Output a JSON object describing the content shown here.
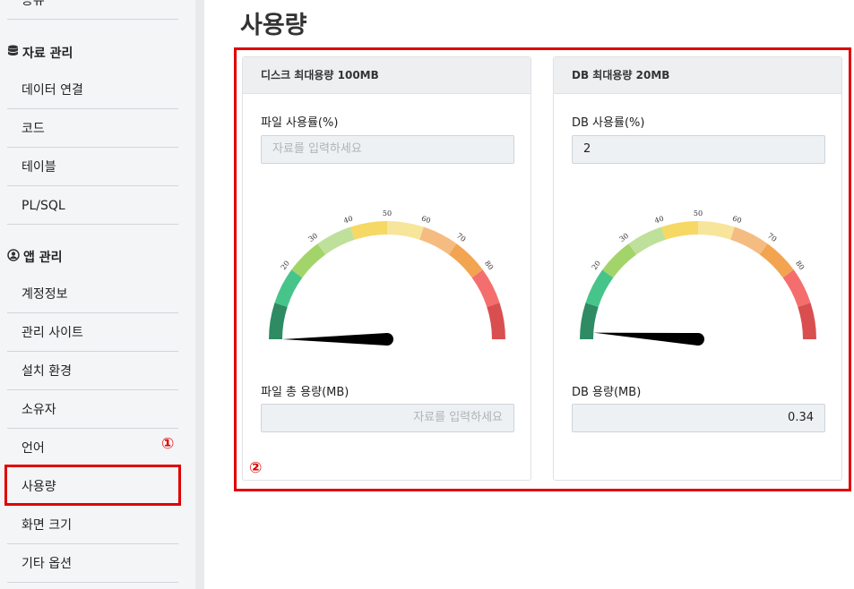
{
  "sidebar": {
    "items_top": [
      "공유"
    ],
    "section_data": {
      "label": "자료 관리",
      "icon": "database-icon"
    },
    "data_items": [
      "데이터 연결",
      "코드",
      "테이블",
      "PL/SQL"
    ],
    "section_app": {
      "label": "앱 관리",
      "icon": "user-circle-icon"
    },
    "app_items": [
      "계정정보",
      "관리 사이트",
      "설치 환경",
      "소유자",
      "언어",
      "사용량",
      "화면 크기",
      "기타 옵션"
    ],
    "selected": "사용량"
  },
  "annotations": {
    "marker1": "①",
    "marker2": "②",
    "color": "#e00000"
  },
  "page": {
    "title": "사용량"
  },
  "disk_card": {
    "header": "디스크 최대용량 100MB",
    "usage_label": "파일 사용률(%)",
    "usage_placeholder": "자료를 입력하세요",
    "usage_value": "",
    "gauge_value": 0,
    "total_label": "파일 총 용량(MB)",
    "total_placeholder": "자료를 입력하세요",
    "total_value": ""
  },
  "db_card": {
    "header": "DB 최대용량 20MB",
    "usage_label": "DB 사용률(%)",
    "usage_value": "2",
    "gauge_value": 2,
    "total_label": "DB 용량(MB)",
    "total_value": "0.34"
  },
  "gauge": {
    "ticks": [
      "20",
      "30",
      "40",
      "50",
      "60",
      "70",
      "80"
    ],
    "colors": [
      "#2e8b64",
      "#47c48a",
      "#a3d46a",
      "#bfe09a",
      "#f6d865",
      "#f8e59c",
      "#f5bc82",
      "#f2a451",
      "#f56e6e",
      "#d94f4f"
    ]
  }
}
